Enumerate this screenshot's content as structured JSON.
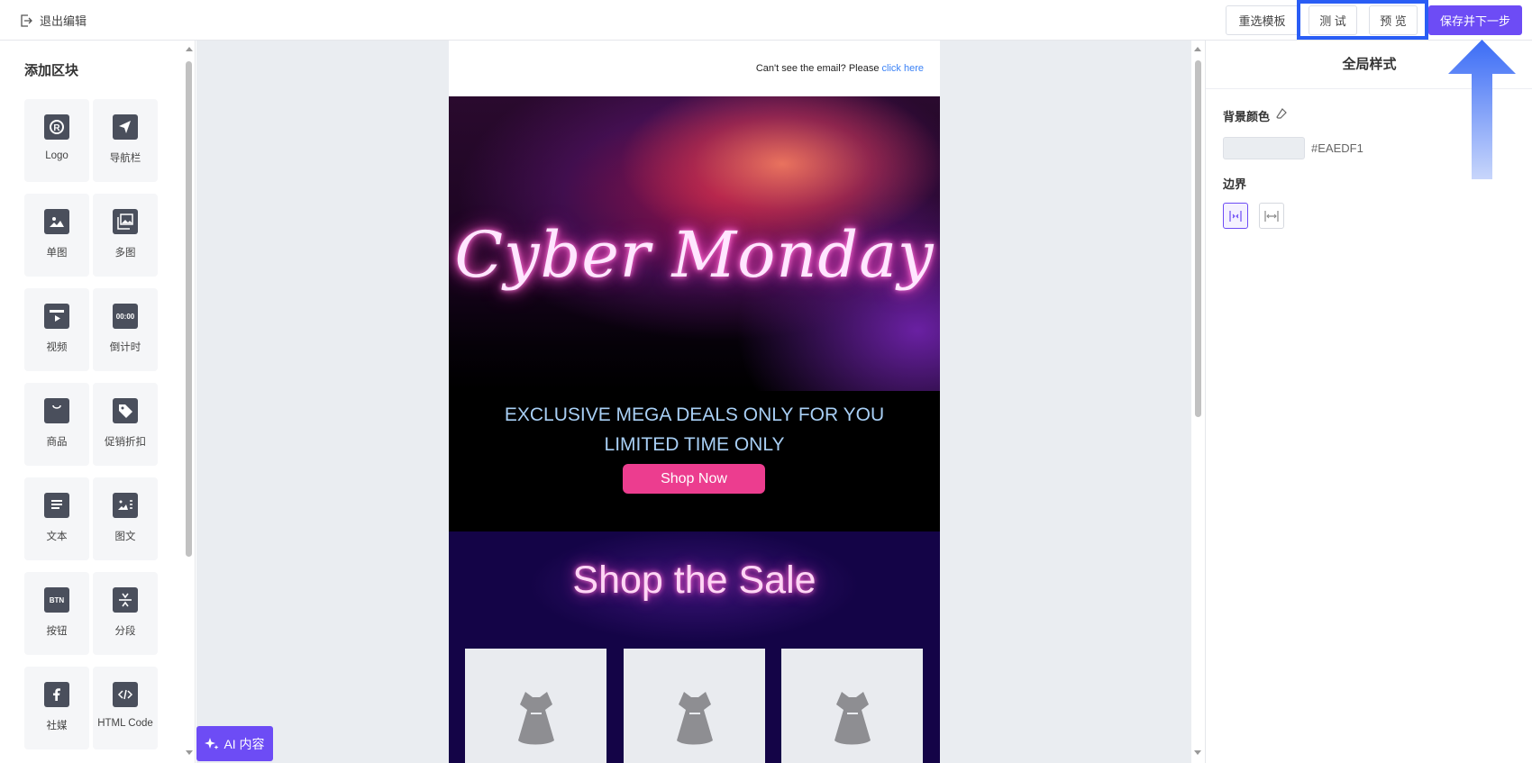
{
  "header": {
    "exit_label": "退出编辑",
    "reselect_label": "重选模板",
    "test_label": "测 试",
    "preview_label": "预 览",
    "save_label": "保存并下一步"
  },
  "left_panel": {
    "title": "添加区块",
    "blocks": [
      {
        "label": "Logo",
        "icon": "logo-icon"
      },
      {
        "label": "导航栏",
        "icon": "navigation-icon"
      },
      {
        "label": "单图",
        "icon": "image-icon"
      },
      {
        "label": "多图",
        "icon": "images-icon"
      },
      {
        "label": "视频",
        "icon": "video-icon"
      },
      {
        "label": "倒计时",
        "icon": "countdown-icon"
      },
      {
        "label": "商品",
        "icon": "shopping-bag-icon"
      },
      {
        "label": "促销折扣",
        "icon": "tag-icon"
      },
      {
        "label": "文本",
        "icon": "text-icon"
      },
      {
        "label": "图文",
        "icon": "image-text-icon"
      },
      {
        "label": "按钮",
        "icon": "button-icon"
      },
      {
        "label": "分段",
        "icon": "divider-icon"
      },
      {
        "label": "社媒",
        "icon": "facebook-icon"
      },
      {
        "label": "HTML Code",
        "icon": "code-icon"
      }
    ],
    "countdown_glyph": "00:00",
    "button_glyph": "BTN"
  },
  "email": {
    "preheader_text": "Can't see the email? Please ",
    "preheader_link": "click here",
    "hero_title": "Cyber Monday",
    "deals_line1": "EXCLUSIVE MEGA DEALS ONLY FOR YOU",
    "deals_line2": "LIMITED TIME ONLY",
    "cta_label": "Shop Now",
    "section_title": "Shop the Sale"
  },
  "right_panel": {
    "title": "全局样式",
    "bg_color_label": "背景颜色",
    "bg_color_value": "#EAEDF1",
    "border_label": "边界"
  },
  "ai_button_label": "AI 内容",
  "colors": {
    "accent": "#6d4cf5",
    "highlight": "#2a5df5",
    "canvas_bg": "#EAEDF1",
    "cta": "#ec3d8f"
  }
}
